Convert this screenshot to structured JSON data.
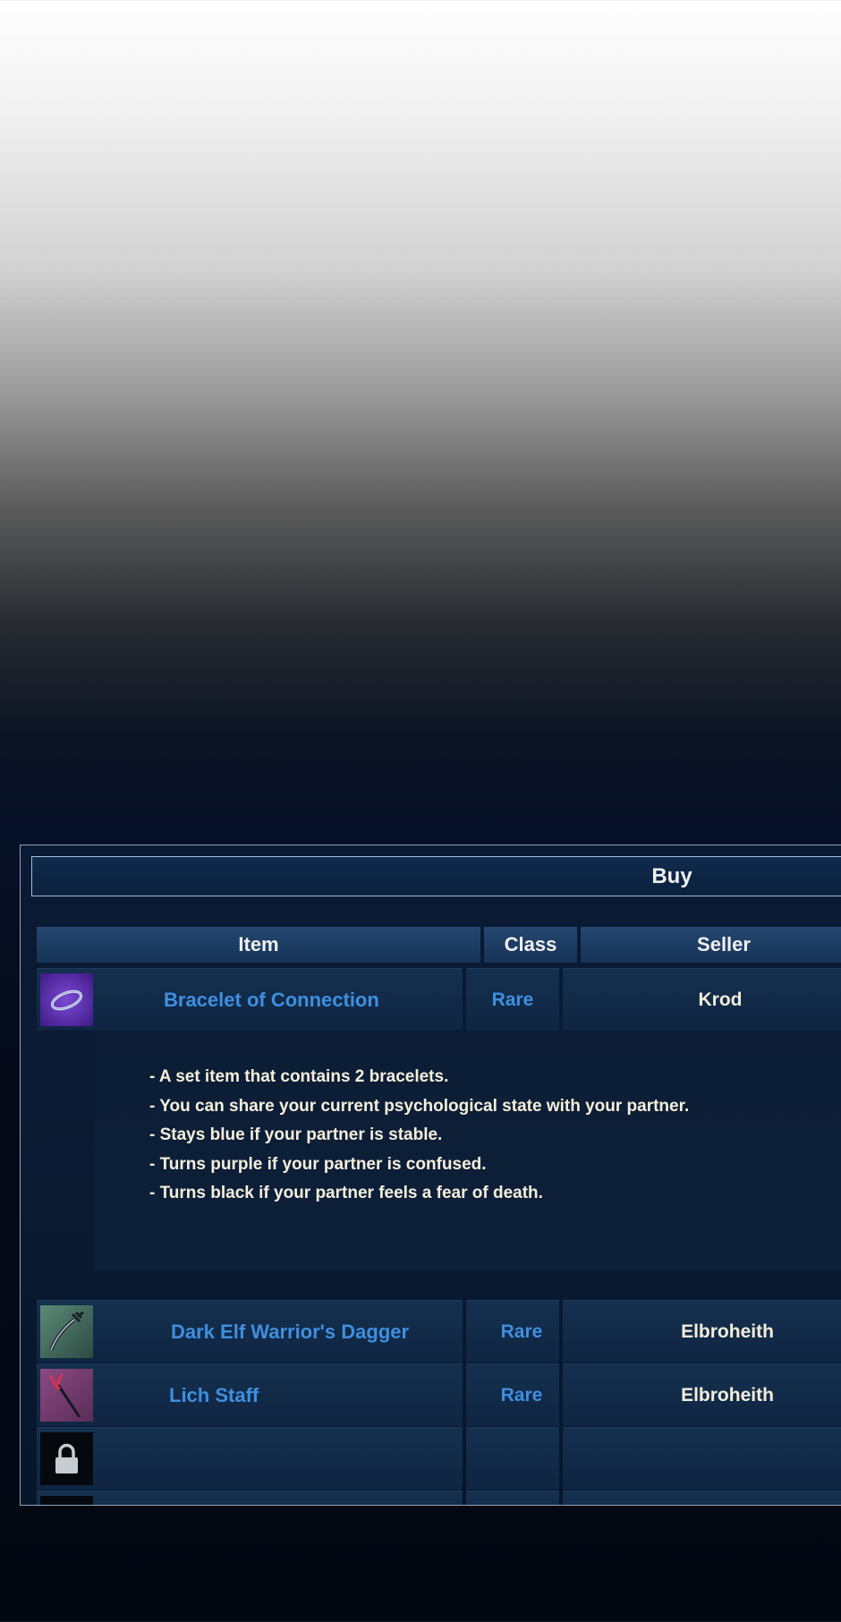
{
  "panel": {
    "title": "Buy"
  },
  "table": {
    "headers": {
      "item": "Item",
      "class": "Class",
      "seller": "Seller"
    },
    "rows": [
      {
        "icon": "bracelet-icon",
        "name": "Bracelet of Connection",
        "class": "Rare",
        "seller": "Krod"
      },
      {
        "icon": "dagger-icon",
        "name": "Dark Elf Warrior's Dagger",
        "class": "Rare",
        "seller": "Elbroheith"
      },
      {
        "icon": "staff-icon",
        "name": "Lich Staff",
        "class": "Rare",
        "seller": "Elbroheith"
      },
      {
        "icon": "lock-icon",
        "name": "",
        "class": "",
        "seller": ""
      }
    ],
    "description": [
      "- A set item that contains 2 bracelets.",
      "- You can share your current psychological state with your partner.",
      "- Stays blue if your partner is stable.",
      "- Turns purple if your partner is confused.",
      "- Turns black if your partner feels a fear of death."
    ]
  },
  "colors": {
    "item_name": "#3f8fe0",
    "seller_text": "#f3eddc",
    "panel_bg": "#0a1b33"
  }
}
